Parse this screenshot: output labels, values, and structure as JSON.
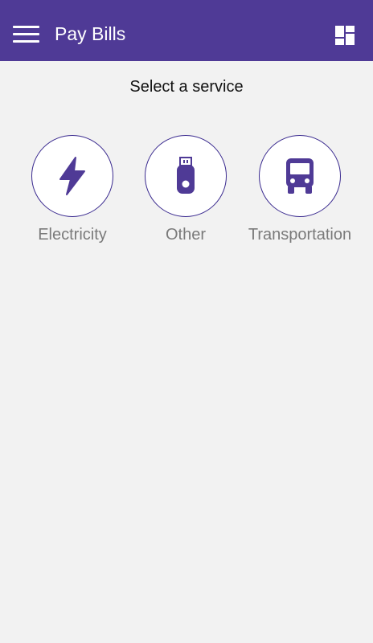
{
  "appbar": {
    "title": "Pay Bills",
    "menu_icon": "hamburger-menu-icon",
    "dashboard_icon": "dashboard-icon",
    "background": "#4f3a96"
  },
  "main": {
    "heading": "Select a service",
    "services": [
      {
        "label": "Electricity",
        "icon": "lightning-bolt-icon"
      },
      {
        "label": "Other",
        "icon": "usb-drive-icon"
      },
      {
        "label": "Transportation",
        "icon": "bus-icon"
      }
    ]
  },
  "colors": {
    "accent": "#4f3a96",
    "circle_border": "#3a2a8f",
    "label_text": "#7a7a7a",
    "page_background": "#f2f2f2"
  }
}
